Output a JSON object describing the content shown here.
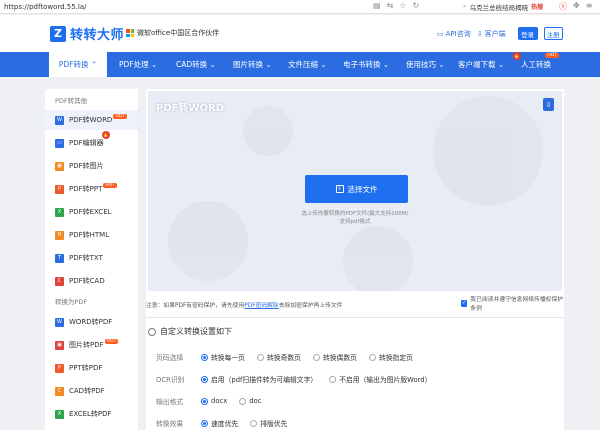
{
  "browser": {
    "url": "https://pdftoword.55.la/",
    "search_text": "乌克兰总统结局揭晓",
    "search_hot": "热搜"
  },
  "header": {
    "logo_text": "转转大师",
    "partner": "微软office中国区合作伙伴",
    "api_link": "API咨询",
    "client_link": "客户端",
    "login": "登录",
    "register": "注册"
  },
  "nav": {
    "items": [
      {
        "label": "PDF转换",
        "arrow": "⌃"
      },
      {
        "label": "PDF处理",
        "arrow": "⌄"
      },
      {
        "label": "CAD转换",
        "arrow": "⌄"
      },
      {
        "label": "图片转换",
        "arrow": "⌄"
      },
      {
        "label": "文件压缩",
        "arrow": "⌄"
      },
      {
        "label": "电子书转换",
        "arrow": "⌄"
      },
      {
        "label": "使用技巧",
        "arrow": "⌄"
      },
      {
        "label": "客户端下载",
        "arrow": "⌄"
      },
      {
        "label": "人工转换",
        "arrow": ""
      }
    ],
    "hot_badge": "HOT",
    "fire_glyph": "🔥"
  },
  "sidebar": {
    "section1": "PDF转其他",
    "section2": "转换为PDF",
    "items1": [
      {
        "label": "PDF转WORD",
        "color": "#2b6de0",
        "glyph": "W"
      },
      {
        "label": "PDF编辑器",
        "color": "#2b6de0",
        "glyph": "▭"
      },
      {
        "label": "PDF转图片",
        "color": "#f08a24",
        "glyph": "▣"
      },
      {
        "label": "PDF转PPT",
        "color": "#ef5a2c",
        "glyph": "P"
      },
      {
        "label": "PDF转EXCEL",
        "color": "#2ea44f",
        "glyph": "X"
      },
      {
        "label": "PDF转HTML",
        "color": "#f08a24",
        "glyph": "H"
      },
      {
        "label": "PDF转TXT",
        "color": "#2b6de0",
        "glyph": "T"
      },
      {
        "label": "PDF转CAD",
        "color": "#e0433b",
        "glyph": "C"
      }
    ],
    "items2": [
      {
        "label": "WORD转PDF",
        "color": "#2b6de0",
        "glyph": "W"
      },
      {
        "label": "图片转PDF",
        "color": "#e0433b",
        "glyph": "▣"
      },
      {
        "label": "PPT转PDF",
        "color": "#ef5a2c",
        "glyph": "P"
      },
      {
        "label": "CAD转PDF",
        "color": "#f08a24",
        "glyph": "C"
      },
      {
        "label": "EXCEL转PDF",
        "color": "#2ea44f",
        "glyph": "X"
      }
    ],
    "hot_tag": "HOT"
  },
  "main": {
    "title": "PDF转WORD",
    "choose_button": "选择文件",
    "hint_line1": "选上传你要转换的PDF文件(最大支持100M)",
    "hint_line2": "支持pdf格式",
    "notice_prefix": "注意：如果PDF有密码保护，请先使用",
    "notice_link": "PDF密码解除",
    "notice_suffix": "去除加密保护再上传文件",
    "agree_text": "我已阅读并遵守信息网络传播权保护条例",
    "settings_title": "自定义转换设置如下",
    "settings": [
      {
        "label": "页码选择",
        "options": [
          {
            "text": "转换每一页",
            "selected": true
          },
          {
            "text": "转换奇数页",
            "selected": false
          },
          {
            "text": "转换偶数页",
            "selected": false
          },
          {
            "text": "转换指定页",
            "selected": false
          }
        ]
      },
      {
        "label": "OCR识别",
        "options": [
          {
            "text": "启用（pdf扫描件转为可编辑文字）",
            "selected": true
          },
          {
            "text": "不启用（输出为图片版Word）",
            "selected": false
          }
        ]
      },
      {
        "label": "输出格式",
        "options": [
          {
            "text": "docx",
            "selected": true
          },
          {
            "text": "doc",
            "selected": false
          }
        ]
      },
      {
        "label": "转换效果",
        "options": [
          {
            "text": "速度优先",
            "selected": true
          },
          {
            "text": "排版优先",
            "selected": false
          }
        ]
      }
    ]
  }
}
